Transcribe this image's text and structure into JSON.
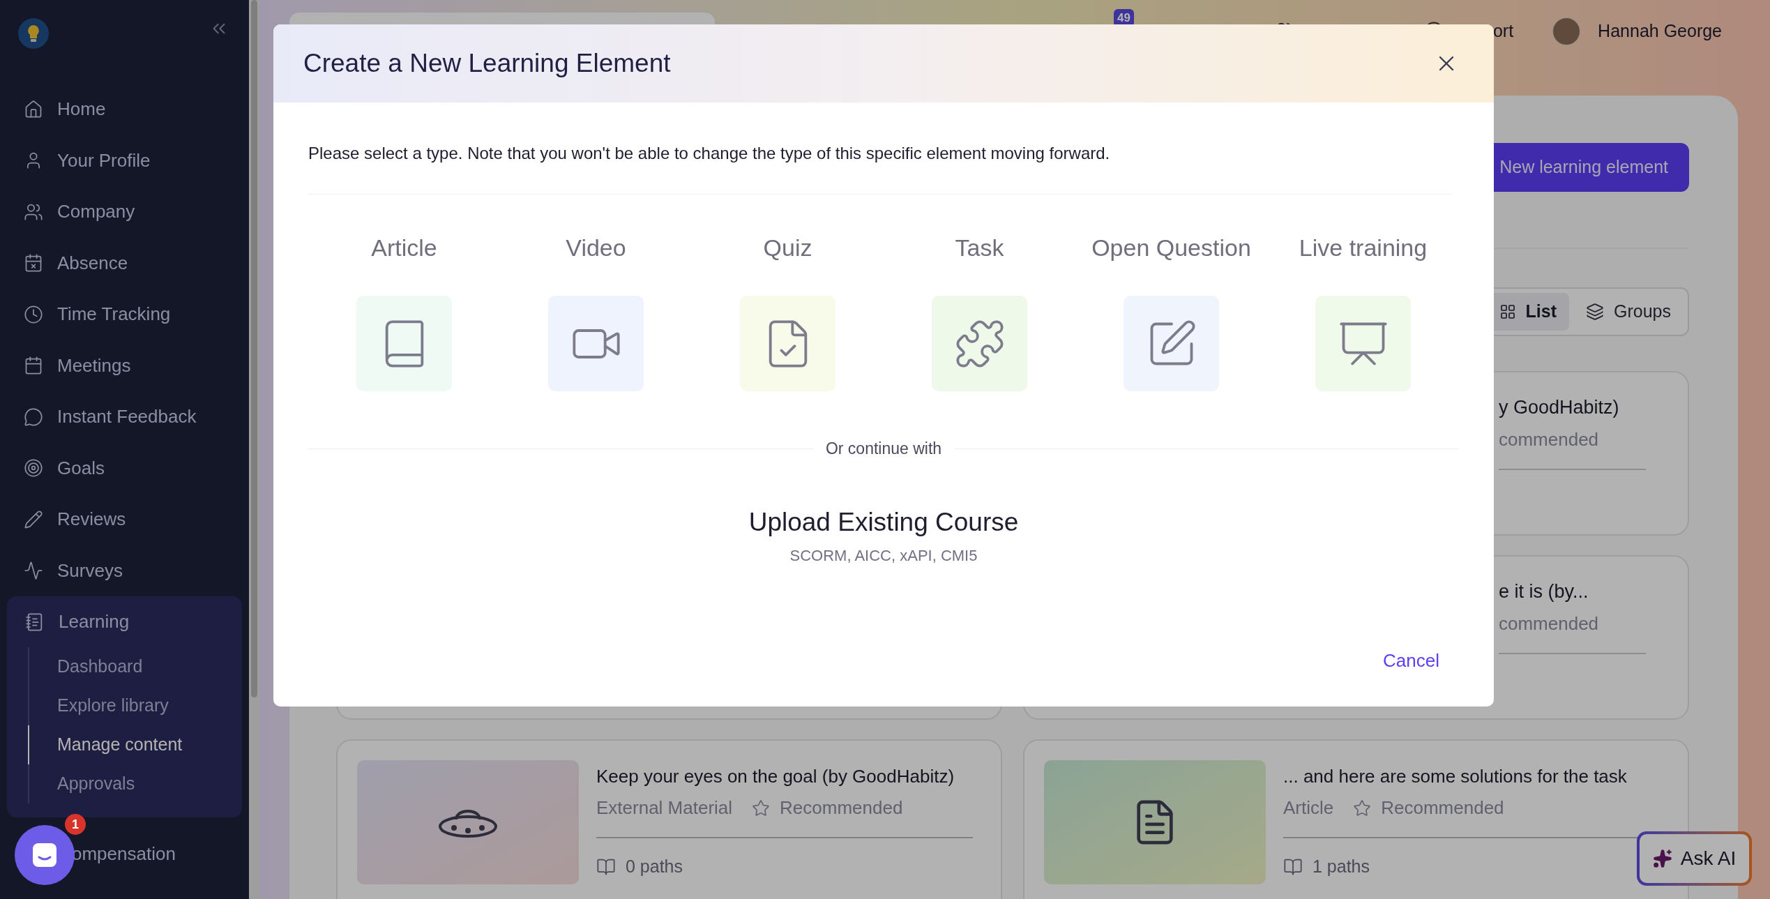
{
  "sidebar": {
    "items": [
      {
        "label": "Home"
      },
      {
        "label": "Your Profile"
      },
      {
        "label": "Company"
      },
      {
        "label": "Absence"
      },
      {
        "label": "Time Tracking"
      },
      {
        "label": "Meetings"
      },
      {
        "label": "Instant Feedback"
      },
      {
        "label": "Goals"
      },
      {
        "label": "Reviews"
      },
      {
        "label": "Surveys"
      },
      {
        "label": "Learning",
        "expanded": true,
        "children": [
          {
            "label": "Dashboard",
            "selected": false
          },
          {
            "label": "Explore library",
            "selected": false
          },
          {
            "label": "Manage content",
            "selected": true
          },
          {
            "label": "Approvals",
            "selected": false
          }
        ]
      },
      {
        "label": "ompensation"
      }
    ]
  },
  "chat_widget": {
    "badge": "1"
  },
  "topbar": {
    "notification_badge": "49",
    "support_label": "ort",
    "user_name": "Hannah George"
  },
  "content": {
    "primary_button": "New learning element",
    "view_toggle": [
      {
        "label": "List",
        "selected": true
      },
      {
        "label": "Groups",
        "selected": false
      }
    ],
    "cards": [
      {
        "kind": "partial",
        "title": "y GoodHabitz)",
        "meta": "commended"
      },
      {
        "kind": "partial",
        "title": "e it is (by...",
        "meta": "commended"
      },
      {
        "kind": "full",
        "title": "Keep your eyes on the goal (by GoodHabitz)",
        "type": "External Material",
        "tag": "Recommended",
        "paths": "0 paths"
      },
      {
        "kind": "full",
        "title": "... and here are some solutions for the task",
        "type": "Article",
        "tag": "Recommended",
        "paths": "1 paths"
      }
    ]
  },
  "ask_ai": "Ask AI",
  "modal": {
    "title": "Create a New Learning Element",
    "description": "Please select a type. Note that you won't be able to change the type of this specific element moving forward.",
    "types": [
      {
        "label": "Article",
        "color": "#effaf5"
      },
      {
        "label": "Video",
        "color": "#eff3fd"
      },
      {
        "label": "Quiz",
        "color": "#f8fbea"
      },
      {
        "label": "Task",
        "color": "#eff9ea"
      },
      {
        "label": "Open Question",
        "color": "#eff4fd"
      },
      {
        "label": "Live training",
        "color": "#f0faea"
      }
    ],
    "divider_text": "Or continue with",
    "upload": {
      "title": "Upload Existing Course",
      "formats": "SCORM, AICC, xAPI, CMI5"
    },
    "cancel": "Cancel"
  }
}
